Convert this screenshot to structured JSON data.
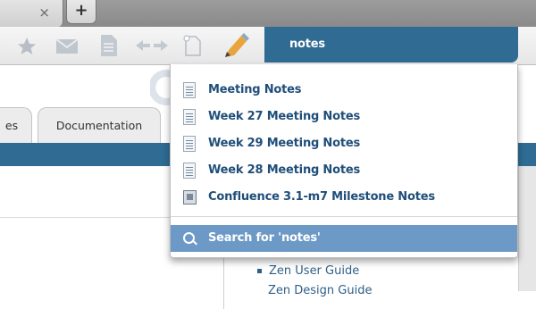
{
  "tabstrip": {
    "close_glyph": "×",
    "new_tab_glyph": "+"
  },
  "toolbar": {
    "icons": [
      "star-icon",
      "mail-icon",
      "page-icon",
      "arrows-icon",
      "new-page-icon",
      "pencil-icon"
    ],
    "search_value": "notes"
  },
  "nav": {
    "tab_partial": "es",
    "tab_documentation": "Documentation"
  },
  "dropdown": {
    "items": [
      {
        "label": "Meeting Notes",
        "icon": "document-icon"
      },
      {
        "label": "Week 27 Meeting Notes",
        "icon": "document-icon"
      },
      {
        "label": "Week 29 Meeting Notes",
        "icon": "document-icon"
      },
      {
        "label": "Week 28 Meeting Notes",
        "icon": "document-icon"
      },
      {
        "label": "Confluence 3.1-m7 Milestone Notes",
        "icon": "milestone-icon"
      }
    ],
    "search_label": "Search for 'notes'"
  },
  "content": {
    "guide_item": "Zen User Guide",
    "guide_item_2": "Zen Design Guide"
  },
  "colors": {
    "accent": "#2f6b93",
    "highlight": "#6d99c6",
    "link": "#1f4e79"
  }
}
